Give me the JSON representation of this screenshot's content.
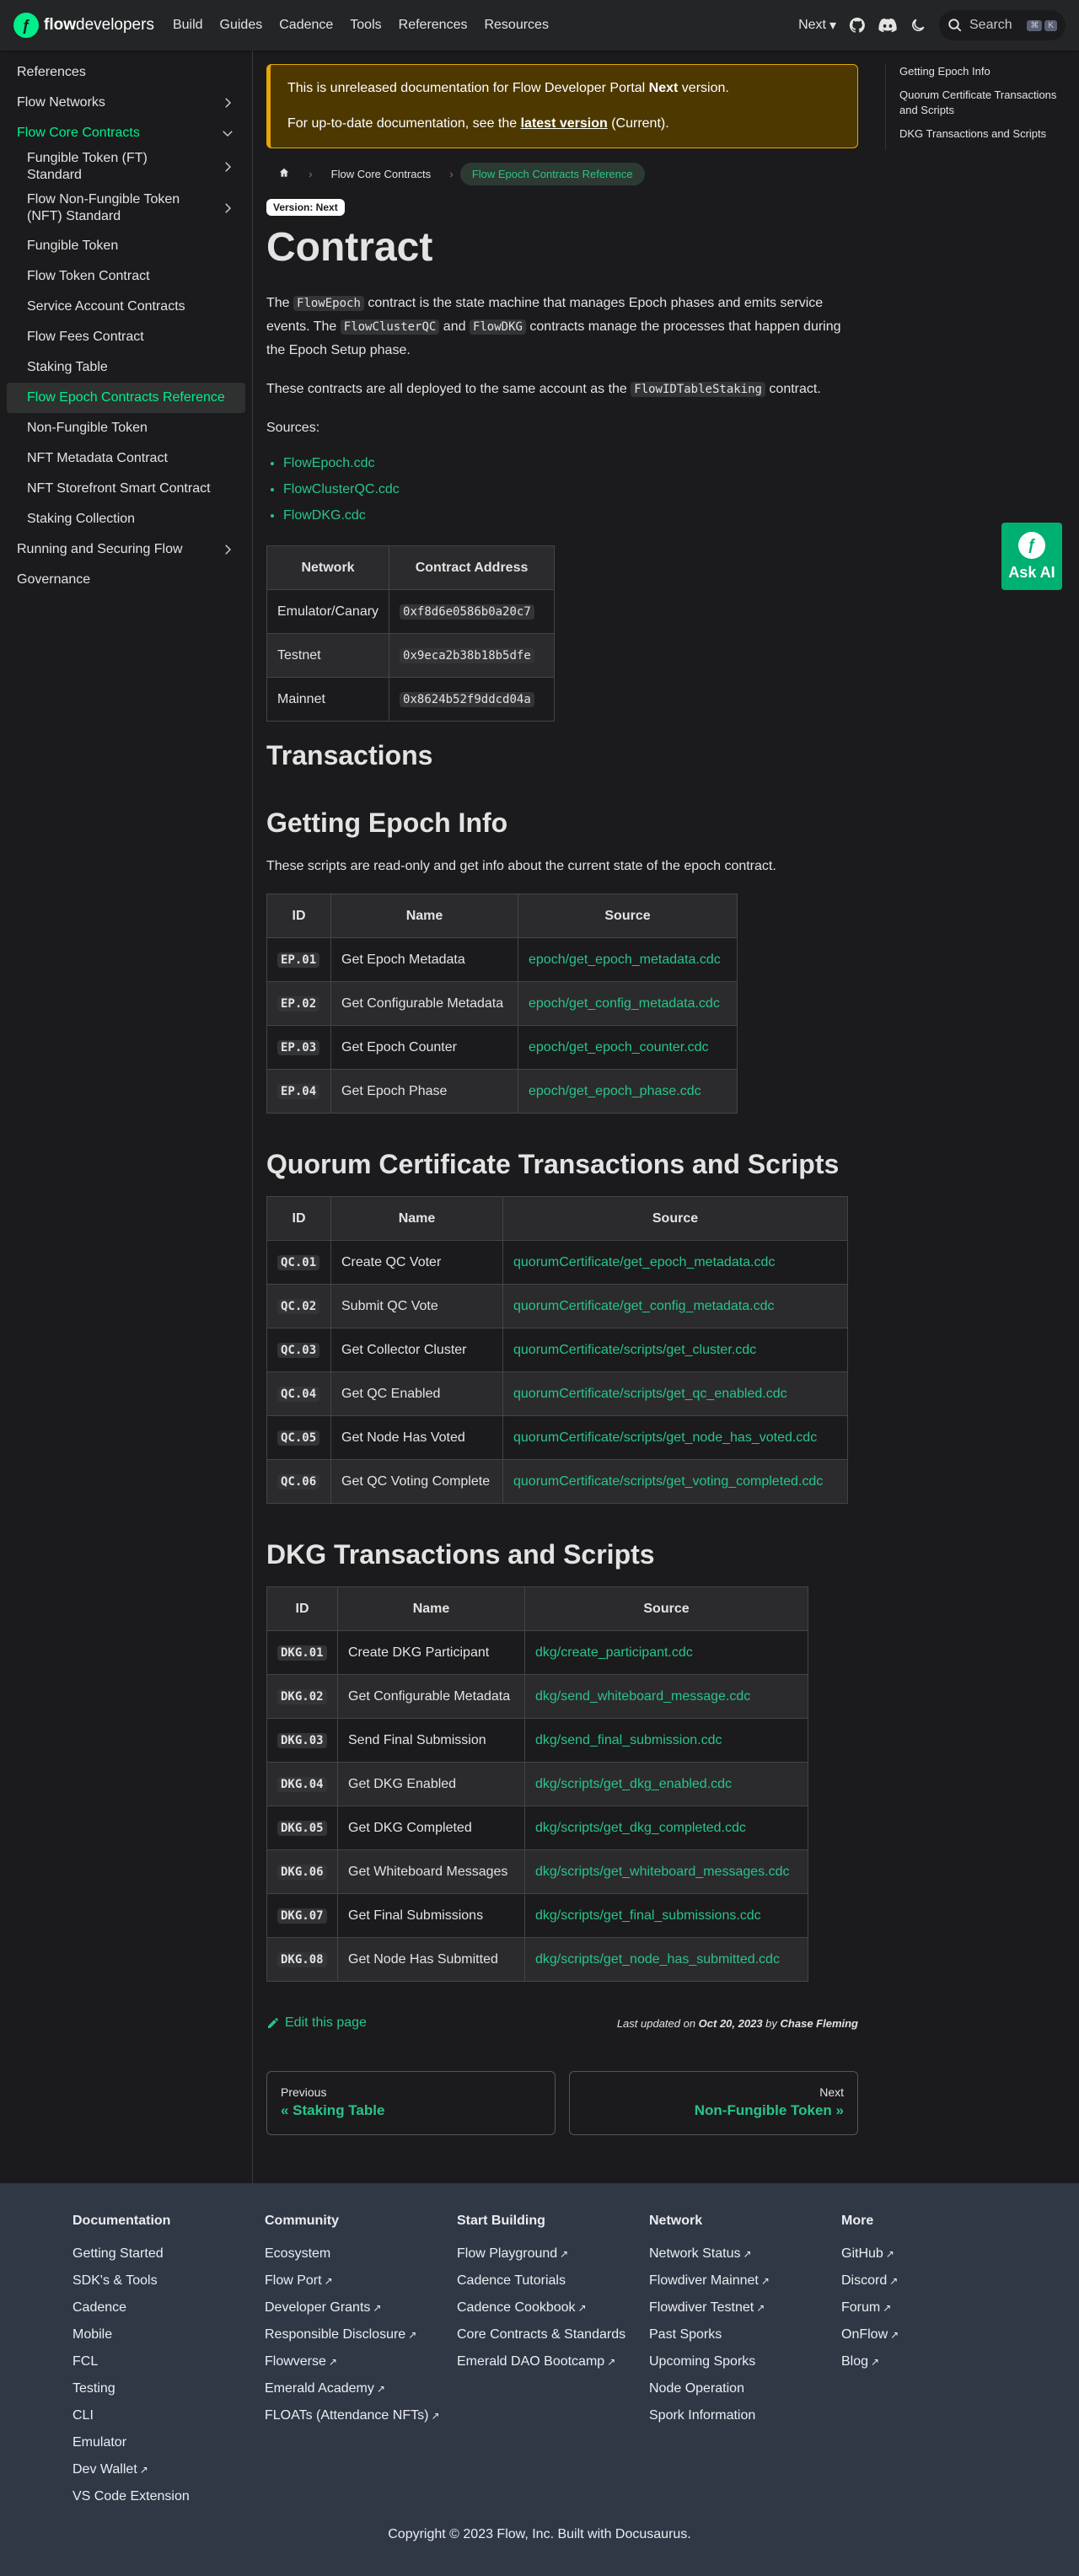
{
  "nav": {
    "brand_bold": "flow",
    "brand_rest": "developers",
    "links": [
      "Build",
      "Guides",
      "Cadence",
      "Tools",
      "References",
      "Resources"
    ],
    "version": "Next",
    "search_label": "Search",
    "kbd1": "⌘",
    "kbd2": "K"
  },
  "sidebar": {
    "items": [
      {
        "label": "References"
      },
      {
        "label": "Flow Networks"
      },
      {
        "label": "Flow Core Contracts"
      },
      {
        "label": "Fungible Token (FT) Standard"
      },
      {
        "label": "Flow Non-Fungible Token (NFT) Standard"
      },
      {
        "label": "Fungible Token"
      },
      {
        "label": "Flow Token Contract"
      },
      {
        "label": "Service Account Contracts"
      },
      {
        "label": "Flow Fees Contract"
      },
      {
        "label": "Staking Table"
      },
      {
        "label": "Flow Epoch Contracts Reference"
      },
      {
        "label": "Non-Fungible Token"
      },
      {
        "label": "NFT Metadata Contract"
      },
      {
        "label": "NFT Storefront Smart Contract"
      },
      {
        "label": "Staking Collection"
      },
      {
        "label": "Running and Securing Flow"
      },
      {
        "label": "Governance"
      }
    ]
  },
  "banner": {
    "line1_pre": "This is unreleased documentation for Flow Developer Portal ",
    "line1_bold": "Next",
    "line1_post": " version.",
    "line2_pre": "For up-to-date documentation, see the ",
    "line2_link": "latest version",
    "line2_post": " (Current)."
  },
  "breadcrumb": {
    "item1": "Flow Core Contracts",
    "item2": "Flow Epoch Contracts Reference"
  },
  "version_badge": "Version: Next",
  "title": "Contract",
  "intro": {
    "p1_a": "The ",
    "p1_code1": "FlowEpoch",
    "p1_b": " contract is the state machine that manages Epoch phases and emits service events. The ",
    "p1_code2": "FlowClusterQC",
    "p1_c": " and ",
    "p1_code3": "FlowDKG",
    "p1_d": " contracts manage the processes that happen during the Epoch Setup phase.",
    "p2_a": "These contracts are all deployed to the same account as the ",
    "p2_code": "FlowIDTableStaking",
    "p2_b": " contract.",
    "sources_label": "Sources:",
    "sources": [
      "FlowEpoch.cdc",
      "FlowClusterQC.cdc",
      "FlowDKG.cdc"
    ]
  },
  "network_table": {
    "headers": [
      "Network",
      "Contract Address"
    ],
    "rows": [
      [
        "Emulator/Canary",
        "0xf8d6e0586b0a20c7"
      ],
      [
        "Testnet",
        "0x9eca2b38b18b5dfe"
      ],
      [
        "Mainnet",
        "0x8624b52f9ddcd04a"
      ]
    ]
  },
  "sections": {
    "transactions": "Transactions",
    "epoch": "Getting Epoch Info",
    "epoch_desc": "These scripts are read-only and get info about the current state of the epoch contract.",
    "qc": "Quorum Certificate Transactions and Scripts",
    "dkg": "DKG Transactions and Scripts"
  },
  "epoch_table": {
    "headers": [
      "ID",
      "Name",
      "Source"
    ],
    "rows": [
      [
        "EP.01",
        "Get Epoch Metadata",
        "epoch/get_epoch_metadata.cdc"
      ],
      [
        "EP.02",
        "Get Configurable Metadata",
        "epoch/get_config_metadata.cdc"
      ],
      [
        "EP.03",
        "Get Epoch Counter",
        "epoch/get_epoch_counter.cdc"
      ],
      [
        "EP.04",
        "Get Epoch Phase",
        "epoch/get_epoch_phase.cdc"
      ]
    ]
  },
  "qc_table": {
    "headers": [
      "ID",
      "Name",
      "Source"
    ],
    "rows": [
      [
        "QC.01",
        "Create QC Voter",
        "quorumCertificate/get_epoch_metadata.cdc"
      ],
      [
        "QC.02",
        "Submit QC Vote",
        "quorumCertificate/get_config_metadata.cdc"
      ],
      [
        "QC.03",
        "Get Collector Cluster",
        "quorumCertificate/scripts/get_cluster.cdc"
      ],
      [
        "QC.04",
        "Get QC Enabled",
        "quorumCertificate/scripts/get_qc_enabled.cdc"
      ],
      [
        "QC.05",
        "Get Node Has Voted",
        "quorumCertificate/scripts/get_node_has_voted.cdc"
      ],
      [
        "QC.06",
        "Get QC Voting Complete",
        "quorumCertificate/scripts/get_voting_completed.cdc"
      ]
    ]
  },
  "dkg_table": {
    "headers": [
      "ID",
      "Name",
      "Source"
    ],
    "rows": [
      [
        "DKG.01",
        "Create DKG Participant",
        "dkg/create_participant.cdc"
      ],
      [
        "DKG.02",
        "Get Configurable Metadata",
        "dkg/send_whiteboard_message.cdc"
      ],
      [
        "DKG.03",
        "Send Final Submission",
        "dkg/send_final_submission.cdc"
      ],
      [
        "DKG.04",
        "Get DKG Enabled",
        "dkg/scripts/get_dkg_enabled.cdc"
      ],
      [
        "DKG.05",
        "Get DKG Completed",
        "dkg/scripts/get_dkg_completed.cdc"
      ],
      [
        "DKG.06",
        "Get Whiteboard Messages",
        "dkg/scripts/get_whiteboard_messages.cdc"
      ],
      [
        "DKG.07",
        "Get Final Submissions",
        "dkg/scripts/get_final_submissions.cdc"
      ],
      [
        "DKG.08",
        "Get Node Has Submitted",
        "dkg/scripts/get_node_has_submitted.cdc"
      ]
    ]
  },
  "edit": {
    "label": "Edit this page",
    "updated_pre": "Last updated on ",
    "updated_date": "Oct 20, 2023",
    "updated_by": " by ",
    "updated_author": "Chase Fleming"
  },
  "pager": {
    "prev_label": "Previous",
    "prev_title": "« Staking Table",
    "next_label": "Next",
    "next_title": "Non-Fungible Token »"
  },
  "toc": [
    "Getting Epoch Info",
    "Quorum Certificate Transactions and Scripts",
    "DKG Transactions and Scripts"
  ],
  "ask_ai": "Ask AI",
  "footer": {
    "columns": [
      {
        "title": "Documentation",
        "links": [
          {
            "label": "Getting Started",
            "ext": false
          },
          {
            "label": "SDK's & Tools",
            "ext": false
          },
          {
            "label": "Cadence",
            "ext": false
          },
          {
            "label": "Mobile",
            "ext": false
          },
          {
            "label": "FCL",
            "ext": false
          },
          {
            "label": "Testing",
            "ext": false
          },
          {
            "label": "CLI",
            "ext": false
          },
          {
            "label": "Emulator",
            "ext": false
          },
          {
            "label": "Dev Wallet",
            "ext": true
          },
          {
            "label": "VS Code Extension",
            "ext": false
          }
        ]
      },
      {
        "title": "Community",
        "links": [
          {
            "label": "Ecosystem",
            "ext": false
          },
          {
            "label": "Flow Port",
            "ext": true
          },
          {
            "label": "Developer Grants",
            "ext": true
          },
          {
            "label": "Responsible Disclosure",
            "ext": true
          },
          {
            "label": "Flowverse",
            "ext": true
          },
          {
            "label": "Emerald Academy",
            "ext": true
          },
          {
            "label": "FLOATs (Attendance NFTs)",
            "ext": true
          }
        ]
      },
      {
        "title": "Start Building",
        "links": [
          {
            "label": "Flow Playground",
            "ext": true
          },
          {
            "label": "Cadence Tutorials",
            "ext": false
          },
          {
            "label": "Cadence Cookbook",
            "ext": true
          },
          {
            "label": "Core Contracts & Standards",
            "ext": false
          },
          {
            "label": "Emerald DAO Bootcamp",
            "ext": true
          }
        ]
      },
      {
        "title": "Network",
        "links": [
          {
            "label": "Network Status",
            "ext": true
          },
          {
            "label": "Flowdiver Mainnet",
            "ext": true
          },
          {
            "label": "Flowdiver Testnet",
            "ext": true
          },
          {
            "label": "Past Sporks",
            "ext": false
          },
          {
            "label": "Upcoming Sporks",
            "ext": false
          },
          {
            "label": "Node Operation",
            "ext": false
          },
          {
            "label": "Spork Information",
            "ext": false
          }
        ]
      },
      {
        "title": "More",
        "links": [
          {
            "label": "GitHub",
            "ext": true
          },
          {
            "label": "Discord",
            "ext": true
          },
          {
            "label": "Forum",
            "ext": true
          },
          {
            "label": "OnFlow",
            "ext": true
          },
          {
            "label": "Blog",
            "ext": true
          }
        ]
      }
    ],
    "copyright": "Copyright © 2023 Flow, Inc. Built with Docusaurus."
  }
}
